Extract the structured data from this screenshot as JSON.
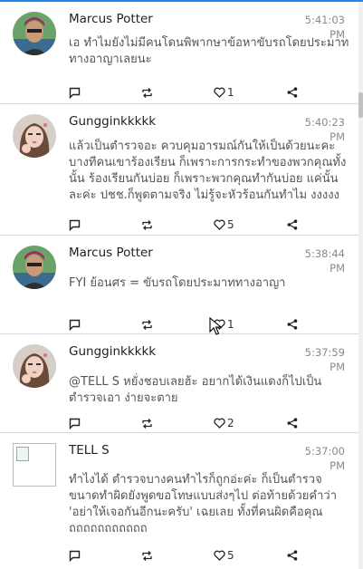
{
  "feed": {
    "posts": [
      {
        "author": "Marcus Potter",
        "time": "5:41:03 PM",
        "text": "เอ ทำไมยังไม่มีคนโดนพิพากษาข้อหาขับรถโดยประมาททางอาญาเลยนะ",
        "likes": "1",
        "avatar": "man-avatar"
      },
      {
        "author": "Gungginkkkkk",
        "time": "5:40:23 PM",
        "text": "แล้วเป็นตำรวจอะ ควบคุมอารมณ์กันให้เป็นด้วยนะคะ บางทีคนเขาร้องเรียน ก็เพราะการกระทำของพวกคุณทั้งนั้น ร้องเรียนกันบ่อย ก็เพราะพวกคุณทำกันบ่อย แค่นั้นละค่ะ ปชช.ก็พูดตามจริง ไม่รู้จะหัวร้อนกันทำไม งงงงง",
        "likes": "5",
        "avatar": "woman-avatar"
      },
      {
        "author": "Marcus Potter",
        "time": "5:38:44 PM",
        "text": "FYI ย้อนศร = ขับรถโดยประมาททางอาญา",
        "likes": "1",
        "avatar": "man-avatar"
      },
      {
        "author": "Gungginkkkkk",
        "time": "5:37:59 PM",
        "text": "@TELL S หยั่งชอบเลยฮ้ะ อยากได้เงินแดงก็ไปเป็นตำรวจเอา ง่ายจะตาย",
        "likes": "2",
        "avatar": "woman-avatar"
      },
      {
        "author": "TELL S",
        "time": "5:37:00 PM",
        "text": "ทำไงได้ ตำรวจบางคนทำไรก็ถูกอ่ะค่ะ ก็เป็นตำรวจ ขนาดทำผิดยังพูดขอโทษแบบส่งๆไป ต่อท้ายด้วยคำว่า 'อย่าให้เจอกันอีกนะครับ' เฉยเลย ทั้งที่คนผิดคือคุณ ถถถถถถถถถถถ",
        "likes": "5",
        "avatar": "broken-image"
      }
    ]
  },
  "colors": {
    "accent": "#1e88e5",
    "time": "#8a8a8a",
    "text": "#555555"
  }
}
